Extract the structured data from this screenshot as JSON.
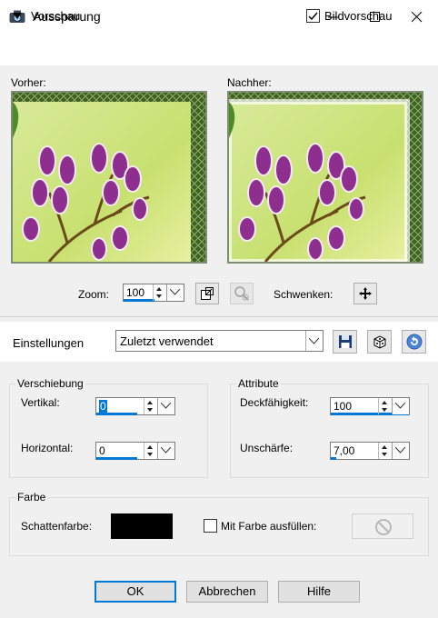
{
  "window": {
    "title": "Aussparung"
  },
  "preview": {
    "section_label": "Vorschau",
    "bildvorschau_label": "Bildvorschau",
    "bildvorschau_checked": true,
    "before_label": "Vorher:",
    "after_label": "Nachher:",
    "zoom_label": "Zoom:",
    "zoom_value": "100",
    "pan_label": "Schwenken:"
  },
  "settings": {
    "label": "Einstellungen",
    "preset_value": "Zuletzt verwendet"
  },
  "verschiebung": {
    "title": "Verschiebung",
    "vertical_label": "Vertikal:",
    "vertical_value": "0",
    "horizontal_label": "Horizontal:",
    "horizontal_value": "0"
  },
  "attribute": {
    "title": "Attribute",
    "opacity_label": "Deckfähigkeit:",
    "opacity_value": "100",
    "blur_label": "Unschärfe:",
    "blur_value": "7,00"
  },
  "farbe": {
    "title": "Farbe",
    "shadow_color_label": "Schattenfarbe:",
    "shadow_color": "#000000",
    "fill_label": "Mit Farbe ausfüllen:",
    "fill_checked": false
  },
  "buttons": {
    "ok": "OK",
    "cancel": "Abbrechen",
    "help": "Hilfe"
  }
}
